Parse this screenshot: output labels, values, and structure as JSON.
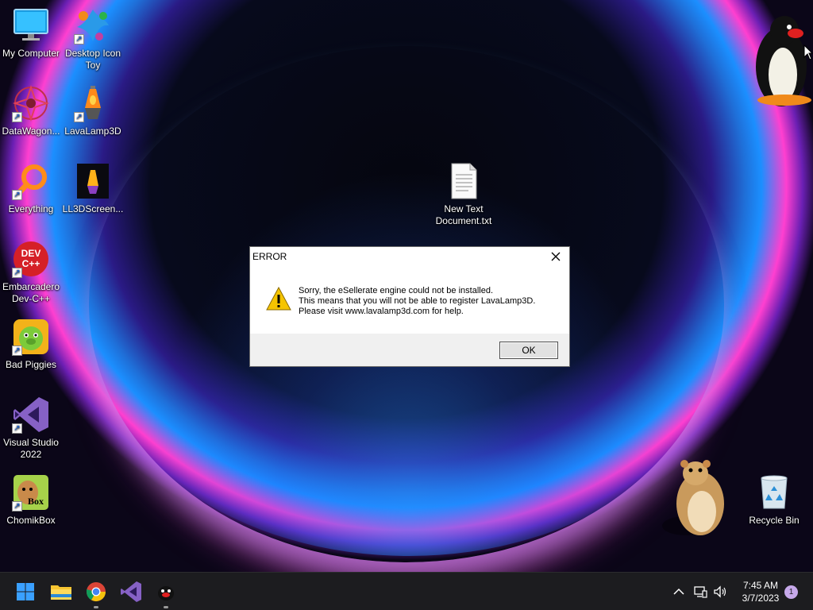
{
  "desktop": {
    "icons": [
      {
        "label": "My Computer"
      },
      {
        "label": "Desktop Icon Toy"
      },
      {
        "label": "DataWagon..."
      },
      {
        "label": "LavaLamp3D"
      },
      {
        "label": "Everything"
      },
      {
        "label": "LL3DScreen..."
      },
      {
        "label": "New Text Document.txt"
      },
      {
        "label": "Embarcadero Dev-C++"
      },
      {
        "label": "Bad Piggies"
      },
      {
        "label": "Visual Studio 2022"
      },
      {
        "label": "ChomikBox"
      },
      {
        "label": "Recycle Bin"
      }
    ],
    "devcpp_logo_text": "DEV C++",
    "chomik_logo_text": "Box"
  },
  "dialog": {
    "title": "ERROR",
    "message_lines": [
      "Sorry, the eSellerate engine could not be installed.",
      "This means that you will not be able to register LavaLamp3D.",
      "Please visit www.lavalamp3d.com for help."
    ],
    "ok_label": "OK",
    "icon": "warning-icon"
  },
  "taskbar": {
    "apps": [
      "start-icon",
      "file-explorer-icon",
      "chrome-icon",
      "visual-studio-icon",
      "penguin-app-icon"
    ],
    "tray": [
      "chevron-up-icon",
      "network-icon",
      "volume-icon"
    ],
    "time": "7:45 AM",
    "date": "3/7/2023",
    "notification_count": "1"
  },
  "colors": {
    "taskbar_bg": "#1c1c1f",
    "dialog_footer": "#f0f0f0",
    "accent_blue": "#1b8fff",
    "accent_pink": "#ff3fd0"
  }
}
